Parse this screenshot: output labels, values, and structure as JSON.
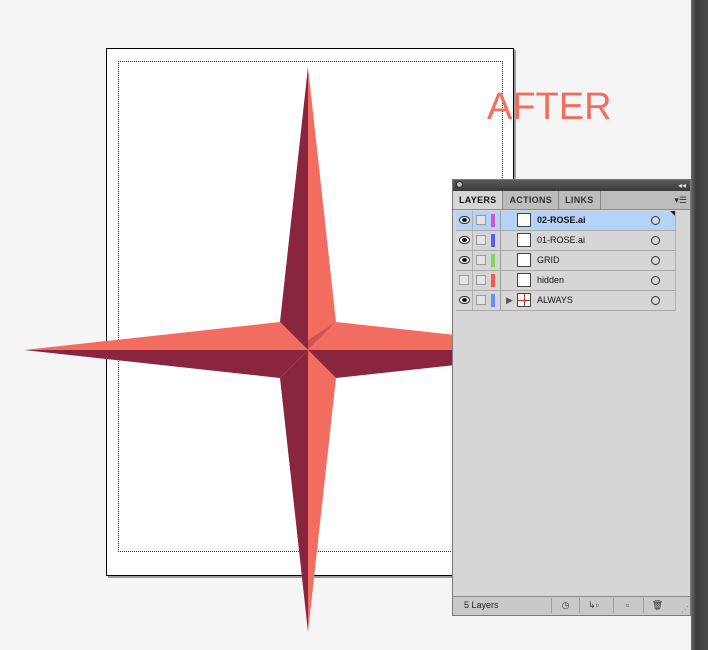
{
  "canvas": {
    "label": "AFTER",
    "label_color": "#f26d5e",
    "star_colors": {
      "light": "#f26d60",
      "dark": "#8a2540"
    }
  },
  "layers_panel": {
    "tabs": [
      {
        "label": "LAYERS",
        "active": true
      },
      {
        "label": "ACTIONS",
        "active": false
      },
      {
        "label": "LINKS",
        "active": false
      }
    ],
    "layers": [
      {
        "name": "02-ROSE.ai",
        "visible": true,
        "color": "#d94ed9",
        "selected": true,
        "bold": true
      },
      {
        "name": "01-ROSE.ai",
        "visible": true,
        "color": "#5a5aff",
        "selected": false,
        "bold": false
      },
      {
        "name": "GRID",
        "visible": true,
        "color": "#7ed957",
        "selected": false,
        "bold": false
      },
      {
        "name": "hidden",
        "visible": false,
        "color": "#f25b4a",
        "selected": false,
        "bold": false
      },
      {
        "name": "ALWAYS",
        "visible": true,
        "color": "#6c8cff",
        "selected": false,
        "bold": false,
        "expandable": true
      }
    ],
    "footer": {
      "layer_count": "5 Layers",
      "buttons": [
        "make-clipping-mask-icon",
        "create-sublayer-icon",
        "new-layer-icon",
        "trash-icon"
      ]
    }
  }
}
